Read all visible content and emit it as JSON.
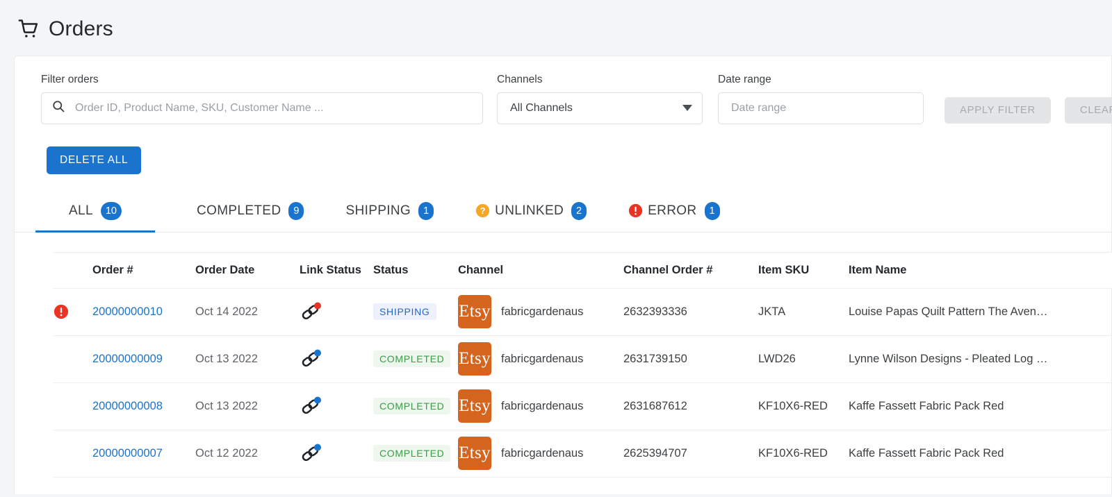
{
  "header": {
    "title": "Orders",
    "icon": "shopping-cart-icon"
  },
  "filters": {
    "search": {
      "label": "Filter orders",
      "placeholder": "Order ID, Product Name, SKU, Customer Name ...",
      "value": "",
      "icon": "search-icon"
    },
    "channels": {
      "label": "Channels",
      "selected": "All Channels",
      "caret_icon": "chevron-down-icon"
    },
    "date_range": {
      "label": "Date range",
      "placeholder": "Date range",
      "value": ""
    },
    "apply_label": "APPLY FILTER",
    "clear_label": "CLEAR"
  },
  "actions": {
    "delete_all_label": "DELETE ALL"
  },
  "tabs": [
    {
      "label": "ALL",
      "count": "10",
      "active": true,
      "icon": null
    },
    {
      "label": "COMPLETED",
      "count": "9",
      "active": false,
      "icon": null
    },
    {
      "label": "SHIPPING",
      "count": "1",
      "active": false,
      "icon": null
    },
    {
      "label": "UNLINKED",
      "count": "2",
      "active": false,
      "icon": "question-circle-icon"
    },
    {
      "label": "ERROR",
      "count": "1",
      "active": false,
      "icon": "error-circle-icon"
    }
  ],
  "table": {
    "columns": [
      "Order #",
      "Order Date",
      "Link Status",
      "Status",
      "Channel",
      "Channel Order #",
      "Item SKU",
      "Item Name"
    ],
    "rows": [
      {
        "flag": "error",
        "order_number": "20000000010",
        "order_date": "Oct 14 2022",
        "link_dot": "red",
        "status": "SHIPPING",
        "status_kind": "shipping",
        "channel_logo": "Etsy",
        "channel_name": "fabricgardenaus",
        "channel_order": "2632393336",
        "sku": "JKTA",
        "item_name": "Louise Papas Quilt Pattern The Aven…"
      },
      {
        "flag": null,
        "order_number": "20000000009",
        "order_date": "Oct 13 2022",
        "link_dot": "blue",
        "status": "COMPLETED",
        "status_kind": "completed",
        "channel_logo": "Etsy",
        "channel_name": "fabricgardenaus",
        "channel_order": "2631739150",
        "sku": "LWD26",
        "item_name": "Lynne Wilson Designs - Pleated Log …"
      },
      {
        "flag": null,
        "order_number": "20000000008",
        "order_date": "Oct 13 2022",
        "link_dot": "blue",
        "status": "COMPLETED",
        "status_kind": "completed",
        "channel_logo": "Etsy",
        "channel_name": "fabricgardenaus",
        "channel_order": "2631687612",
        "sku": "KF10X6-RED",
        "item_name": "Kaffe Fassett Fabric Pack Red"
      },
      {
        "flag": null,
        "order_number": "20000000007",
        "order_date": "Oct 12 2022",
        "link_dot": "blue",
        "status": "COMPLETED",
        "status_kind": "completed",
        "channel_logo": "Etsy",
        "channel_name": "fabricgardenaus",
        "channel_order": "2625394707",
        "sku": "KF10X6-RED",
        "item_name": "Kaffe Fassett Fabric Pack Red"
      }
    ]
  },
  "colors": {
    "accent_blue": "#1a73cc",
    "etsy_orange": "#d5641e",
    "error_red": "#ea3323",
    "warning_orange": "#f5a623",
    "completed_green": "#3c9a46"
  }
}
